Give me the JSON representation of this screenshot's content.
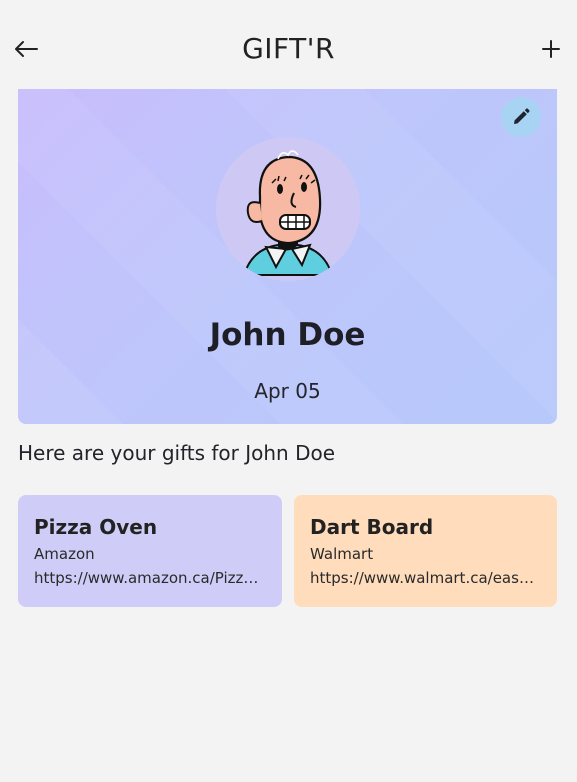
{
  "header": {
    "title": "GIFT'R",
    "back_icon": "arrow-left-icon",
    "add_icon": "plus-icon"
  },
  "profile": {
    "name": "John Doe",
    "date": "Apr 05",
    "edit_icon": "pencil-icon",
    "avatar": "cartoon-bald-man-avatar"
  },
  "gifts_heading": "Here are your gifts for John Doe",
  "gifts": [
    {
      "name": "Pizza Oven",
      "store": "Amazon",
      "url": "https://www.amazon.ca/Pizza-Oven",
      "color": "#cfcdf7"
    },
    {
      "name": "Dart Board",
      "store": "Walmart",
      "url": "https://www.walmart.ca/easy-dart-board",
      "color": "#fedcbc"
    }
  ],
  "colors": {
    "background": "#f3f3f3",
    "banner_gradient_start": "#c8bdfc",
    "banner_gradient_end": "#b7c8fb",
    "edit_button": "#a9d3f2"
  }
}
